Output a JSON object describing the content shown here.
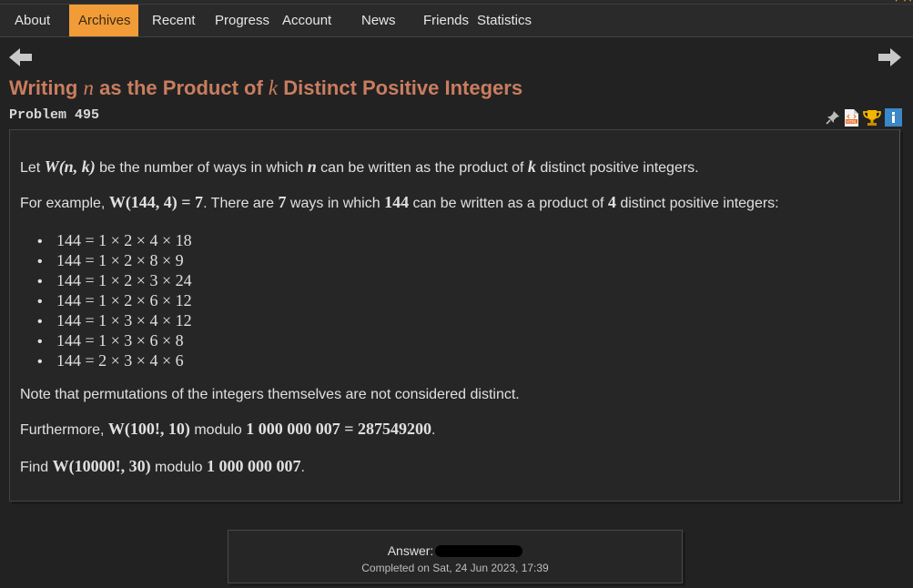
{
  "nav": {
    "items": [
      "About",
      "Archives",
      "Recent",
      "Progress",
      "Account",
      "News",
      "Friends",
      "Statistics"
    ],
    "active": "Archives"
  },
  "icons": {
    "back": "left-arrow-icon",
    "forward": "right-arrow-icon",
    "pin": "pin-icon",
    "html": "html-file-icon",
    "trophy": "trophy-icon",
    "info": "info-icon"
  },
  "colors": {
    "accent": "#f29c38",
    "title": "#c97d5f",
    "background": "#222222",
    "panel": "#262626"
  },
  "problem": {
    "title_pre": "Writing ",
    "title_n": "n",
    "title_mid": " as the Product of ",
    "title_k": "k",
    "title_post": " Distinct Positive Integers",
    "number_label": "Problem 495",
    "p1": {
      "a": "Let ",
      "m": "W(n, k)",
      "b": " be the number of ways in which ",
      "n": "n",
      "c": " can be written as the product of ",
      "k": "k",
      "d": " distinct positive integers."
    },
    "p2": {
      "a": "For example, ",
      "m1": "W(144, 4) = 7",
      "b": ". There are ",
      "m2": "7",
      "c": " ways in which ",
      "m3": "144",
      "d": " can be written as a product of ",
      "m4": "4",
      "e": " distinct positive integers:"
    },
    "examples": [
      "144 = 1 × 2 × 4 × 18",
      "144 = 1 × 2 × 8 × 9",
      "144 = 1 × 2 × 3 × 24",
      "144 = 1 × 2 × 6 × 12",
      "144 = 1 × 3 × 4 × 12",
      "144 = 1 × 3 × 6 × 8",
      "144 = 2 × 3 × 4 × 6"
    ],
    "p3": "Note that permutations of the integers themselves are not considered distinct.",
    "p4": {
      "a": "Furthermore, ",
      "m1": "W(100!, 10)",
      "b": " modulo ",
      "m2": "1 000 000 007 = 287549200",
      "c": "."
    },
    "p5": {
      "a": "Find ",
      "m1": "W(10000!, 30)",
      "b": " modulo ",
      "m2": "1 000 000 007",
      "c": "."
    }
  },
  "answer": {
    "label": "Answer:",
    "completed": "Completed on Sat, 24 Jun 2023, 17:39"
  }
}
